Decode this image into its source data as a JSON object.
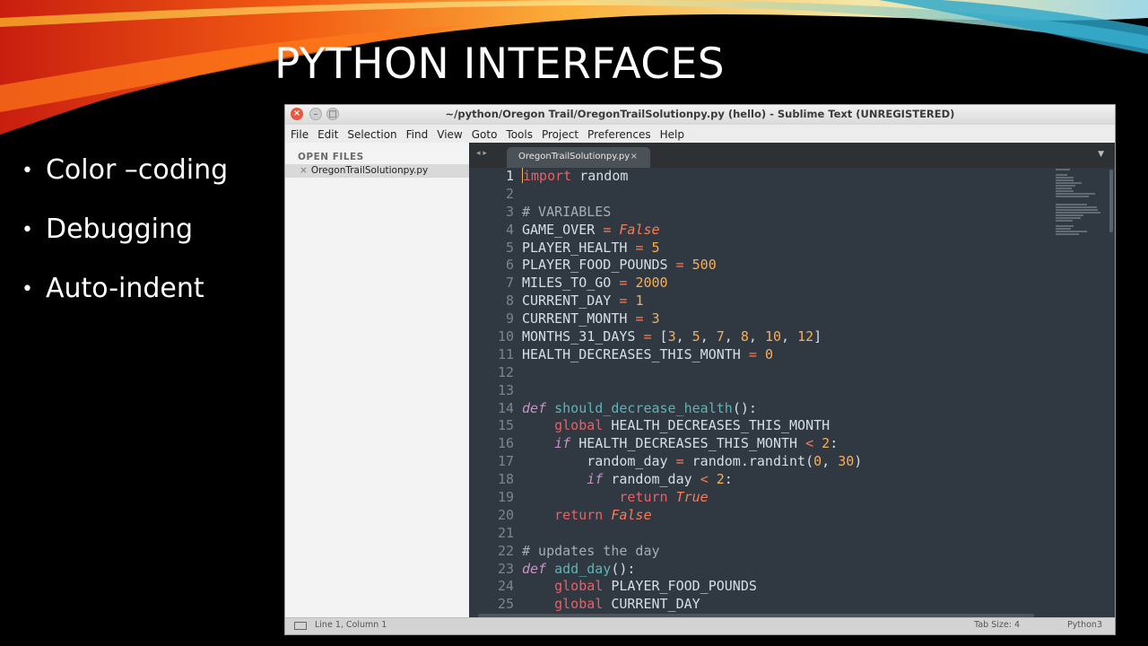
{
  "slide": {
    "title": "PYTHON INTERFACES",
    "bullets": [
      "Color –coding",
      "Debugging",
      "Auto-indent"
    ]
  },
  "window": {
    "title": "~/python/Oregon Trail/OregonTrailSolutionpy.py (hello) - Sublime Text (UNREGISTERED)",
    "close_glyph": "×",
    "min_glyph": "–",
    "max_glyph": "□"
  },
  "menu": [
    "File",
    "Edit",
    "Selection",
    "Find",
    "View",
    "Goto",
    "Tools",
    "Project",
    "Preferences",
    "Help"
  ],
  "sidebar": {
    "header": "OPEN FILES",
    "files": [
      {
        "name": "OregonTrailSolutionpy.py",
        "close": "×"
      }
    ]
  },
  "tabs": {
    "nav_arrows": "◂ ▸",
    "items": [
      {
        "label": "OregonTrailSolutionpy.py",
        "close": "×"
      }
    ],
    "dropdown_glyph": "▼"
  },
  "editor": {
    "line_numbers": [
      "1",
      "2",
      "3",
      "4",
      "5",
      "6",
      "7",
      "8",
      "9",
      "10",
      "11",
      "12",
      "13",
      "14",
      "15",
      "16",
      "17",
      "18",
      "19",
      "20",
      "21",
      "22",
      "23",
      "24",
      "25"
    ],
    "current_line": 1,
    "lines": [
      [
        [
          "kw",
          "import"
        ],
        [
          "t",
          " random"
        ]
      ],
      [],
      [
        [
          "cm",
          "# VARIABLES"
        ]
      ],
      [
        [
          "t",
          "GAME_OVER "
        ],
        [
          "op",
          "="
        ],
        [
          "t",
          " "
        ],
        [
          "const",
          "False"
        ]
      ],
      [
        [
          "t",
          "PLAYER_HEALTH "
        ],
        [
          "op",
          "="
        ],
        [
          "t",
          " "
        ],
        [
          "num",
          "5"
        ]
      ],
      [
        [
          "t",
          "PLAYER_FOOD_POUNDS "
        ],
        [
          "op",
          "="
        ],
        [
          "t",
          " "
        ],
        [
          "num",
          "500"
        ]
      ],
      [
        [
          "t",
          "MILES_TO_GO "
        ],
        [
          "op",
          "="
        ],
        [
          "t",
          " "
        ],
        [
          "num",
          "2000"
        ]
      ],
      [
        [
          "t",
          "CURRENT_DAY "
        ],
        [
          "op",
          "="
        ],
        [
          "t",
          " "
        ],
        [
          "num",
          "1"
        ]
      ],
      [
        [
          "t",
          "CURRENT_MONTH "
        ],
        [
          "op",
          "="
        ],
        [
          "t",
          " "
        ],
        [
          "num",
          "3"
        ]
      ],
      [
        [
          "t",
          "MONTHS_31_DAYS "
        ],
        [
          "op",
          "="
        ],
        [
          "t",
          " ["
        ],
        [
          "num",
          "3"
        ],
        [
          "t",
          ", "
        ],
        [
          "num",
          "5"
        ],
        [
          "t",
          ", "
        ],
        [
          "num",
          "7"
        ],
        [
          "t",
          ", "
        ],
        [
          "num",
          "8"
        ],
        [
          "t",
          ", "
        ],
        [
          "num",
          "10"
        ],
        [
          "t",
          ", "
        ],
        [
          "num",
          "12"
        ],
        [
          "t",
          "]"
        ]
      ],
      [
        [
          "t",
          "HEALTH_DECREASES_THIS_MONTH "
        ],
        [
          "op",
          "="
        ],
        [
          "t",
          " "
        ],
        [
          "num",
          "0"
        ]
      ],
      [],
      [],
      [
        [
          "def",
          "def"
        ],
        [
          "t",
          " "
        ],
        [
          "fn",
          "should_decrease_health"
        ],
        [
          "t",
          "():"
        ]
      ],
      [
        [
          "t",
          "    "
        ],
        [
          "kw",
          "global"
        ],
        [
          "t",
          " HEALTH_DECREASES_THIS_MONTH"
        ]
      ],
      [
        [
          "t",
          "    "
        ],
        [
          "def",
          "if"
        ],
        [
          "t",
          " HEALTH_DECREASES_THIS_MONTH "
        ],
        [
          "op",
          "<"
        ],
        [
          "t",
          " "
        ],
        [
          "num",
          "2"
        ],
        [
          "t",
          ":"
        ]
      ],
      [
        [
          "t",
          "        random_day "
        ],
        [
          "op",
          "="
        ],
        [
          "t",
          " random.randint("
        ],
        [
          "num",
          "0"
        ],
        [
          "t",
          ", "
        ],
        [
          "num",
          "30"
        ],
        [
          "t",
          ")"
        ]
      ],
      [
        [
          "t",
          "        "
        ],
        [
          "def",
          "if"
        ],
        [
          "t",
          " random_day "
        ],
        [
          "op",
          "<"
        ],
        [
          "t",
          " "
        ],
        [
          "num",
          "2"
        ],
        [
          "t",
          ":"
        ]
      ],
      [
        [
          "t",
          "            "
        ],
        [
          "kw",
          "return"
        ],
        [
          "t",
          " "
        ],
        [
          "const",
          "True"
        ]
      ],
      [
        [
          "t",
          "    "
        ],
        [
          "kw",
          "return"
        ],
        [
          "t",
          " "
        ],
        [
          "const",
          "False"
        ]
      ],
      [],
      [
        [
          "cm",
          "# updates the day"
        ]
      ],
      [
        [
          "def",
          "def"
        ],
        [
          "t",
          " "
        ],
        [
          "fn",
          "add_day"
        ],
        [
          "t",
          "():"
        ]
      ],
      [
        [
          "t",
          "    "
        ],
        [
          "kw",
          "global"
        ],
        [
          "t",
          " PLAYER_FOOD_POUNDS"
        ]
      ],
      [
        [
          "t",
          "    "
        ],
        [
          "kw",
          "global"
        ],
        [
          "t",
          " CURRENT_DAY"
        ]
      ]
    ]
  },
  "status": {
    "position": "Line 1, Column 1",
    "tab_size": "Tab Size: 4",
    "syntax": "Python3"
  },
  "colors": {
    "editor_bg": "#303841",
    "keyword": "#ec5f66",
    "storage": "#c594c5",
    "constant": "#f97b58",
    "number": "#f9ae58",
    "function": "#5fb4b4",
    "comment": "#a6acb9",
    "text": "#d8dee9"
  }
}
